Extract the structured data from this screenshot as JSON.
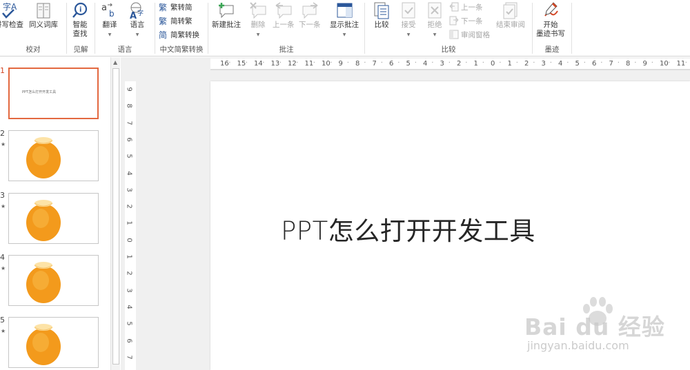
{
  "ribbon": {
    "groups": {
      "proofing": {
        "label": "校对",
        "spell_check": "拼写检查",
        "thesaurus": "同义词库"
      },
      "insights": {
        "label": "见解",
        "smart_lookup_line1": "智能",
        "smart_lookup_line2": "查找"
      },
      "language": {
        "label": "语言",
        "translate": "翻译",
        "language": "语言"
      },
      "chinese_conversion": {
        "label": "中文简繁转换",
        "to_simplified": "繁转简",
        "to_traditional": "简转繁",
        "convert": "简繁转换"
      },
      "comments": {
        "label": "批注",
        "new_comment": "新建批注",
        "delete": "删除",
        "previous": "上一条",
        "next": "下一条",
        "show_comments": "显示批注"
      },
      "compare": {
        "label": "比较",
        "compare": "比较",
        "accept": "接受",
        "reject": "拒绝",
        "prev_change": "上一条",
        "next_change": "下一条",
        "reviewing_pane": "审阅窗格",
        "end_review": "结束审阅"
      },
      "ink": {
        "label": "墨迹",
        "start_inking_line1": "开始",
        "start_inking_line2": "墨迹书写"
      }
    }
  },
  "thumbnails": [
    {
      "number": "1",
      "title": "PPT怎么打开开发工具",
      "has_animation": false,
      "active": true
    },
    {
      "number": "2",
      "has_animation": true,
      "active": false
    },
    {
      "number": "3",
      "has_animation": true,
      "active": false
    },
    {
      "number": "4",
      "has_animation": true,
      "active": false
    },
    {
      "number": "5",
      "has_animation": true,
      "active": false
    }
  ],
  "ruler": {
    "horizontal": [
      "16",
      "15",
      "14",
      "13",
      "12",
      "11",
      "10",
      "9",
      "8",
      "7",
      "6",
      "5",
      "4",
      "3",
      "2",
      "1",
      "0",
      "1",
      "2",
      "3",
      "4",
      "5",
      "6",
      "7",
      "8",
      "9",
      "10",
      "11"
    ],
    "vertical": [
      "9",
      "8",
      "7",
      "6",
      "5",
      "4",
      "3",
      "2",
      "1",
      "0",
      "1",
      "2",
      "3",
      "4",
      "5",
      "6",
      "7"
    ]
  },
  "slide": {
    "title": "PPT怎么打开开发工具"
  },
  "watermark": {
    "brand": "Bai du 经验",
    "url": "jingyan.baidu.com"
  },
  "colors": {
    "accent": "#d24726",
    "active_border": "#e3683f",
    "ribbon_icon_blue": "#2b579a"
  }
}
